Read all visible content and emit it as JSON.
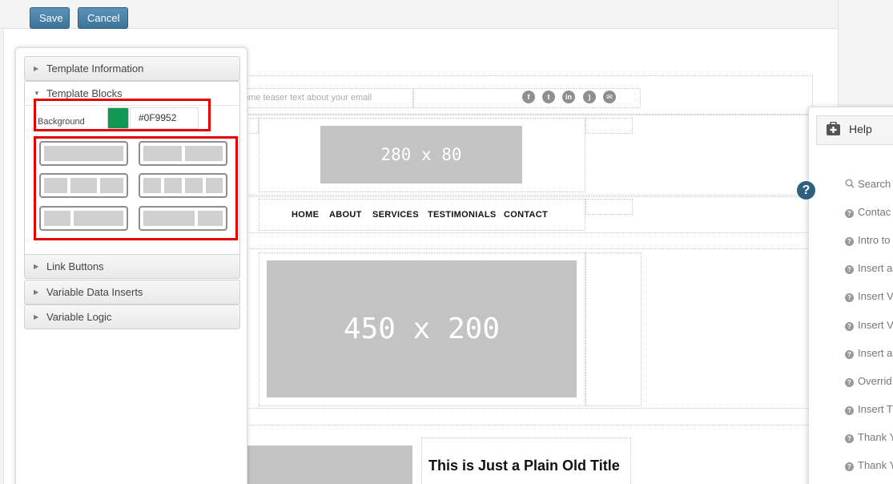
{
  "toolbar": {
    "save_label": "Save",
    "cancel_label": "Cancel"
  },
  "left_panel": {
    "sections": [
      {
        "label": "Template Information",
        "expanded": false
      },
      {
        "label": "Template Blocks",
        "expanded": true
      },
      {
        "label": "Link Buttons",
        "expanded": false
      },
      {
        "label": "Variable Data Inserts",
        "expanded": false
      },
      {
        "label": "Variable Logic",
        "expanded": false
      }
    ],
    "background_label": "Background",
    "background_value": "#0F9952",
    "background_color": "#0F9952",
    "highlight_color": "#e30000"
  },
  "email": {
    "teaser": "ome teaser text about your email",
    "social_icons": [
      "facebook-icon",
      "twitter-icon",
      "linkedin-icon",
      "rss-icon",
      "email-icon"
    ],
    "logo_placeholder": "280 x 80",
    "nav": [
      "HOME",
      "ABOUT",
      "SERVICES",
      "TESTIMONIALS",
      "CONTACT"
    ],
    "hero_placeholder": "450 x 200",
    "plain_title": "This is Just a Plain Old Title"
  },
  "help": {
    "title": "Help",
    "items": [
      "Search",
      "Contac",
      "Intro to",
      "Insert a",
      "Insert V",
      "Insert V",
      "Insert a",
      "Overrid",
      "Insert T",
      "Thank Y",
      "Thank Y"
    ]
  }
}
